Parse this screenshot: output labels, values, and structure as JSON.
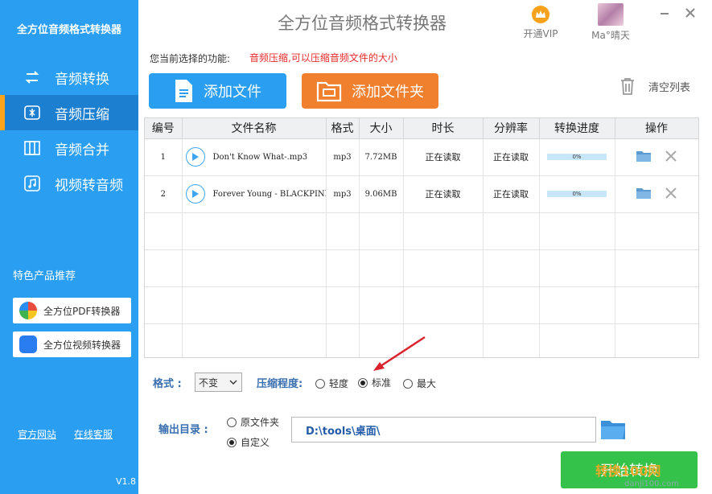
{
  "sidebar": {
    "brand": "全方位音频格式转换器",
    "items": [
      {
        "label": "音频转换"
      },
      {
        "label": "音频压缩"
      },
      {
        "label": "音频合并"
      },
      {
        "label": "视频转音频"
      }
    ],
    "promo_title": "特色产品推荐",
    "promos": [
      {
        "label": "全方位PDF转换器"
      },
      {
        "label": "全方位视频转换器"
      }
    ],
    "links": {
      "official": "官方网站",
      "service": "在线客服"
    },
    "version": "V1.8"
  },
  "header": {
    "title": "全方位音频格式转换器",
    "vip": "开通VIP",
    "user": "Ma°晴天"
  },
  "function": {
    "label": "您当前选择的功能:",
    "desc": "音频压缩,可以压缩音频文件的大小"
  },
  "toolbar": {
    "add_file": "添加文件",
    "add_folder": "添加文件夹",
    "clear": "清空列表",
    "add_file_color": "#2a9ef0",
    "add_folder_color": "#f07f2e"
  },
  "table": {
    "headers": [
      "编号",
      "文件名称",
      "格式",
      "大小",
      "时长",
      "分辨率",
      "转换进度",
      "操作"
    ],
    "rows": [
      {
        "no": "1",
        "name": "Don't  Know  What-.mp3",
        "format": "mp3",
        "size": "7.72MB",
        "duration": "正在读取",
        "resolution": "正在读取",
        "progress": "0%"
      },
      {
        "no": "2",
        "name": "Forever  Young - BLACKPINK",
        "format": "mp3",
        "size": "9.06MB",
        "duration": "正在读取",
        "resolution": "正在读取",
        "progress": "0%"
      }
    ]
  },
  "options": {
    "format_label": "格式 :",
    "format_value": "不变",
    "compress_label": "压缩程度:",
    "levels": [
      {
        "label": "轻度",
        "checked": false
      },
      {
        "label": "标准",
        "checked": true
      },
      {
        "label": "最大",
        "checked": false
      }
    ],
    "output_label": "输出目录 :",
    "output_options": [
      {
        "label": "原文件夹",
        "checked": false
      },
      {
        "label": "自定义",
        "checked": true
      }
    ],
    "output_path": "D:\\tools\\桌面\\"
  },
  "start_button": "开始转换",
  "watermark": {
    "site": "转换100网",
    "url": "danji100.com"
  }
}
